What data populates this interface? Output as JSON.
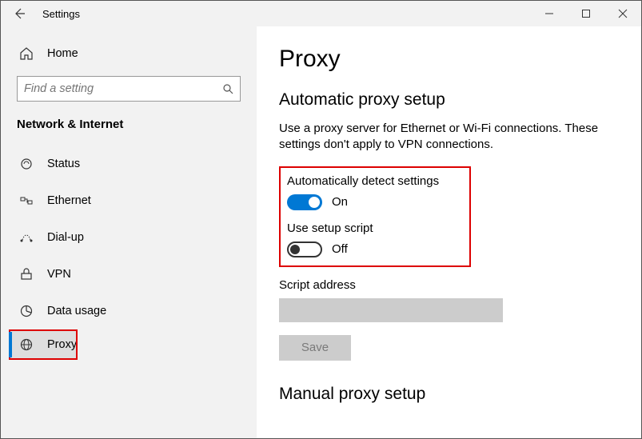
{
  "window": {
    "title": "Settings"
  },
  "sidebar": {
    "home": "Home",
    "search_placeholder": "Find a setting",
    "section": "Network & Internet",
    "items": [
      {
        "label": "Status"
      },
      {
        "label": "Ethernet"
      },
      {
        "label": "Dial-up"
      },
      {
        "label": "VPN"
      },
      {
        "label": "Data usage"
      },
      {
        "label": "Proxy"
      }
    ]
  },
  "main": {
    "title": "Proxy",
    "auto_heading": "Automatic proxy setup",
    "auto_desc": "Use a proxy server for Ethernet or Wi-Fi connections. These settings don't apply to VPN connections.",
    "auto_detect_label": "Automatically detect settings",
    "auto_detect_state": "On",
    "setup_script_label": "Use setup script",
    "setup_script_state": "Off",
    "script_address_label": "Script address",
    "script_address_value": "",
    "save_label": "Save",
    "manual_heading": "Manual proxy setup"
  }
}
